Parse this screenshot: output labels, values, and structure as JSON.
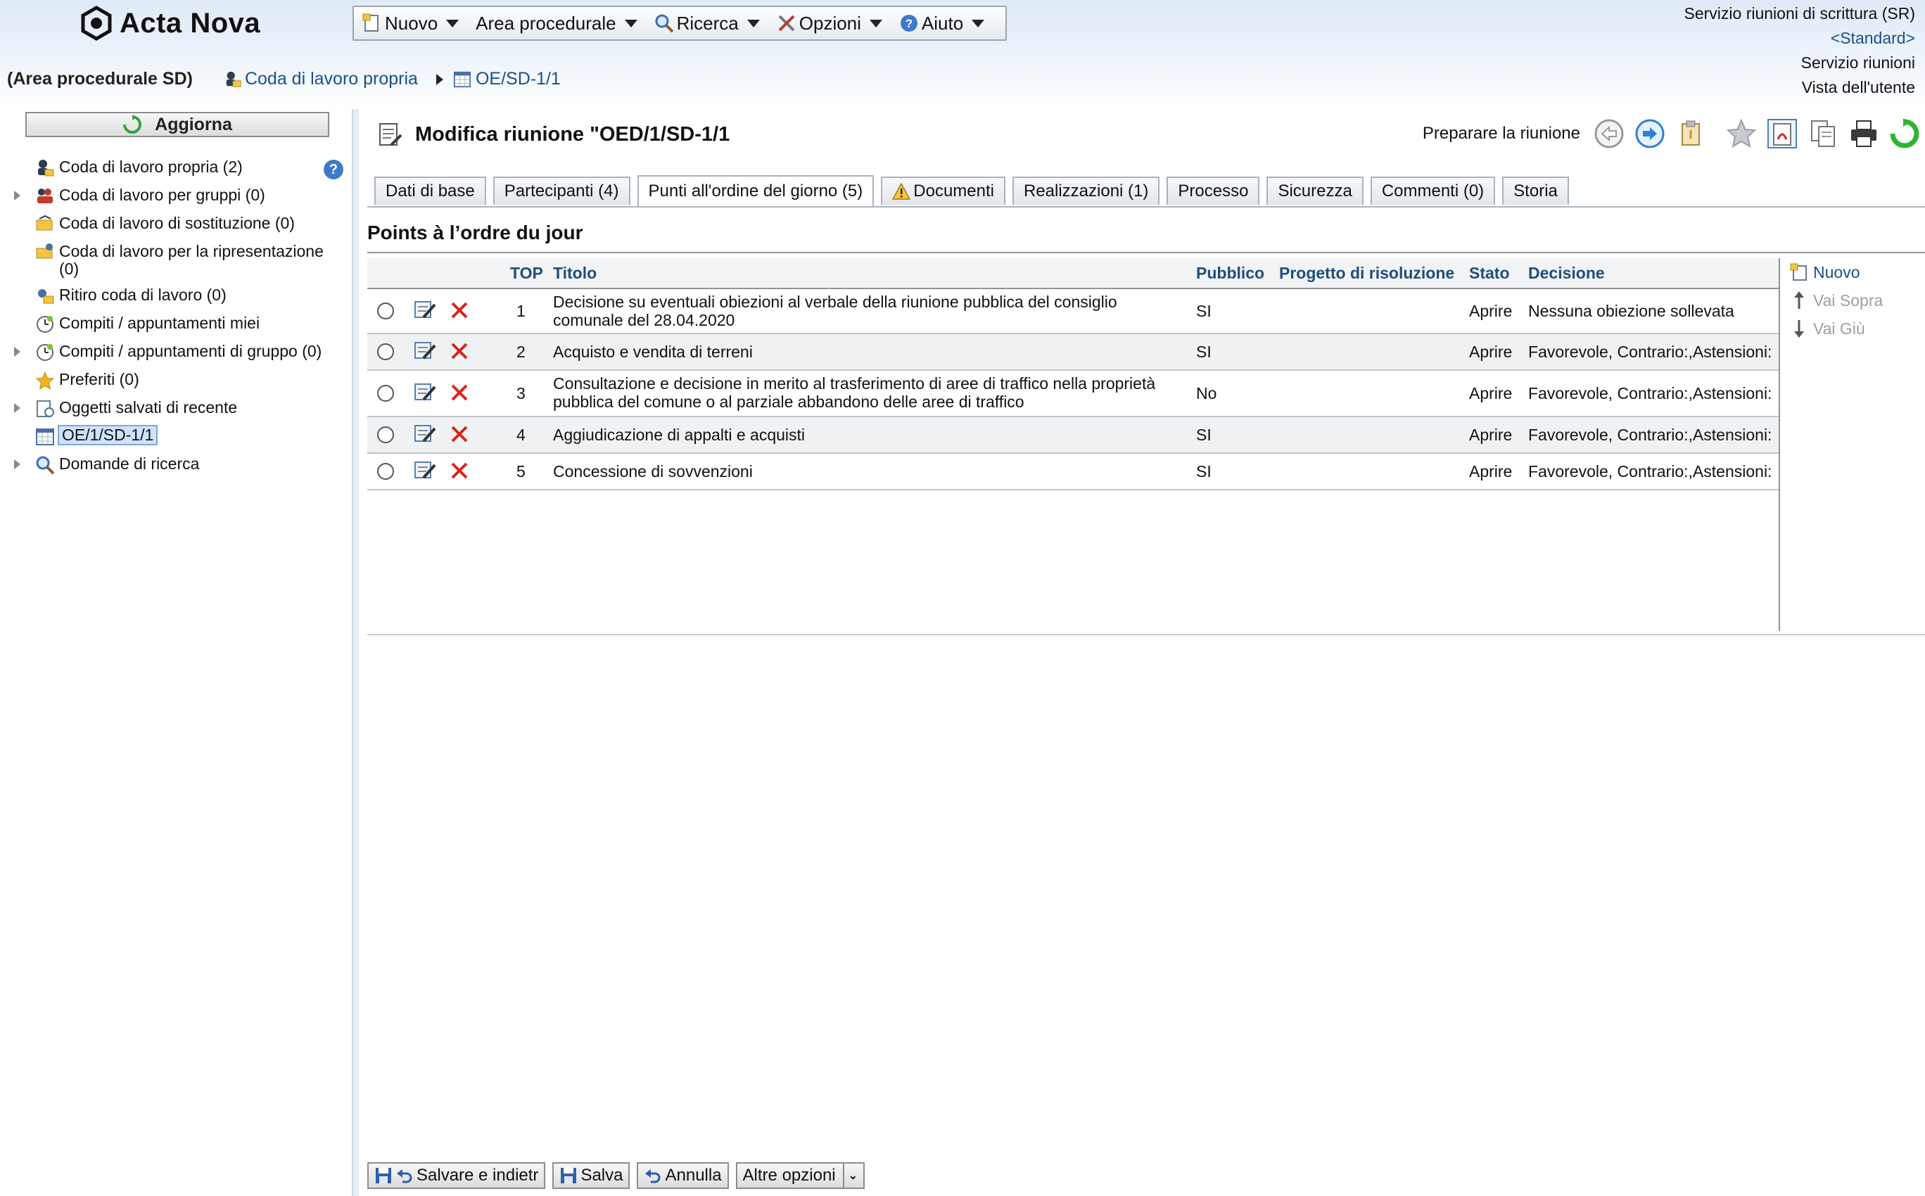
{
  "app": {
    "name": "Acta Nova",
    "menu": [
      {
        "label": "Nuovo",
        "icon": "new-document-icon"
      },
      {
        "label": "Area procedurale",
        "icon": ""
      },
      {
        "label": "Ricerca",
        "icon": "search-icon"
      },
      {
        "label": "Opzioni",
        "icon": "tools-icon"
      },
      {
        "label": "Aiuto",
        "icon": "help-icon"
      }
    ],
    "user": {
      "line1": "Servizio riunioni di scrittura (SR)",
      "line2": "<Standard>",
      "line3": "Servizio riunioni",
      "line4": "Vista dell'utente"
    }
  },
  "breadcrumb": {
    "area": "(Area procedurale SD)",
    "items": [
      "Coda di lavoro propria",
      "OE/SD-1/1"
    ]
  },
  "sidebar": {
    "refresh_label": "Aggiorna",
    "items": [
      {
        "label": "Coda di lavoro propria (2)",
        "icon": "person-queue-icon",
        "expandable": false
      },
      {
        "label": "Coda di lavoro per gruppi (0)",
        "icon": "group-queue-icon",
        "expandable": true
      },
      {
        "label": "Coda di lavoro di sostituzione (0)",
        "icon": "substitution-queue-icon",
        "expandable": false
      },
      {
        "label": "Coda di lavoro per la ripresentazione (0)",
        "icon": "resubmission-queue-icon",
        "expandable": false
      },
      {
        "label": "Ritiro coda di lavoro (0)",
        "icon": "withdrawal-queue-icon",
        "expandable": false
      },
      {
        "label": "Compiti / appuntamenti miei",
        "icon": "clock-icon",
        "expandable": false
      },
      {
        "label": "Compiti / appuntamenti di gruppo (0)",
        "icon": "clock-icon",
        "expandable": true
      },
      {
        "label": "Preferiti (0)",
        "icon": "star-icon",
        "expandable": false
      },
      {
        "label": "Oggetti salvati di recente",
        "icon": "recent-objects-icon",
        "expandable": true
      },
      {
        "label": "OE/1/SD-1/1",
        "icon": "calendar-icon",
        "expandable": false
      },
      {
        "label": "Domande di ricerca",
        "icon": "search-icon",
        "expandable": true
      }
    ]
  },
  "page": {
    "title": "Modifica riunione \"OED/1/SD-1/1",
    "prepare_label": "Preparare la riunione",
    "tabs": [
      {
        "label": "Dati di base",
        "active": false
      },
      {
        "label": "Partecipanti (4)",
        "active": false
      },
      {
        "label": "Punti all'ordine del giorno (5)",
        "active": true
      },
      {
        "label": "Documenti",
        "active": false,
        "warning": true
      },
      {
        "label": "Realizzazioni (1)",
        "active": false
      },
      {
        "label": "Processo",
        "active": false
      },
      {
        "label": "Sicurezza",
        "active": false
      },
      {
        "label": "Commenti (0)",
        "active": false
      },
      {
        "label": "Storia",
        "active": false
      }
    ],
    "section_title": "Points à l’ordre du jour"
  },
  "agenda": {
    "columns": [
      "TOP",
      "Titolo",
      "Pubblico",
      "Progetto di risoluzione",
      "Stato",
      "Decisione"
    ],
    "rows": [
      {
        "top": "1",
        "title": "Decisione su eventuali obiezioni al verbale della riunione pubblica del consiglio comunale del 28.04.2020",
        "public": "SI",
        "draft": "",
        "state": "Aprire",
        "decision": "Nessuna obiezione sollevata"
      },
      {
        "top": "2",
        "title": "Acquisto e vendita di terreni",
        "public": "SI",
        "draft": "",
        "state": "Aprire",
        "decision": "Favorevole, Contrario:,Astensioni:"
      },
      {
        "top": "3",
        "title": "Consultazione e decisione in merito al trasferimento di aree di traffico nella proprietà pubblica del comune o al parziale abbandono delle aree di traffico",
        "public": "No",
        "draft": "",
        "state": "Aprire",
        "decision": "Favorevole, Contrario:,Astensioni:"
      },
      {
        "top": "4",
        "title": "Aggiudicazione di appalti e acquisti",
        "public": "SI",
        "draft": "",
        "state": "Aprire",
        "decision": "Favorevole, Contrario:,Astensioni:"
      },
      {
        "top": "5",
        "title": "Concessione di sovvenzioni",
        "public": "SI",
        "draft": "",
        "state": "Aprire",
        "decision": "Favorevole, Contrario:,Astensioni:"
      }
    ],
    "side_actions": {
      "new": "Nuovo",
      "up": "Vai Sopra",
      "down": "Vai Giù"
    }
  },
  "footer": {
    "save_back": "Salvare e indietr",
    "save": "Salva",
    "cancel": "Annulla",
    "more": "Altre opzioni"
  },
  "colors": {
    "link": "#1a4f8a",
    "header_text": "#1f4e7e",
    "delete_red": "#d8261c"
  }
}
